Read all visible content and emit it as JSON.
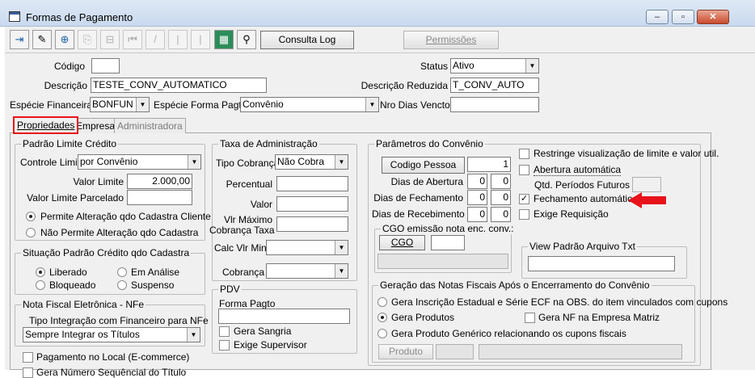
{
  "window": {
    "title": "Formas de Pagamento"
  },
  "toolbar": {
    "consulta_log": "Consulta Log",
    "permissoes": "Permissões"
  },
  "header": {
    "codigo_label": "Código",
    "codigo_value": "",
    "status_label": "Status",
    "status_value": "Ativo",
    "descricao_label": "Descrição",
    "descricao_value": "TESTE_CONV_AUTOMATICO",
    "descricao_reduzida_label": "Descrição Reduzida",
    "descricao_reduzida_value": "T_CONV_AUTO",
    "especie_financeira_label": "Espécie Financeira",
    "especie_financeira_value": "BONFUN",
    "especie_forma_label": "Espécie Forma Pagto",
    "especie_forma_value": "Convênio",
    "nro_dias_label": "Nro Dias Vencto",
    "nro_dias_value": ""
  },
  "tabs": [
    "Propriedades",
    "Empresas",
    "Administradora"
  ],
  "padrao_limite": {
    "title": "Padrão Limite Crédito",
    "controle_label": "Controle Limite",
    "controle_value": "por Convênio",
    "valor_limite_label": "Valor Limite",
    "valor_limite_value": "2.000,00",
    "valor_parcelado_label": "Valor Limite Parcelado",
    "valor_parcelado_value": "",
    "radio1": "Permite Alteração qdo Cadastra Cliente",
    "radio2": "Não Permite Alteração qdo Cadastra"
  },
  "situacao": {
    "title": "Situação Padrão Crédito qdo Cadastra",
    "liberado": "Liberado",
    "em_analise": "Em Análise",
    "bloqueado": "Bloqueado",
    "suspenso": "Suspenso"
  },
  "nfe": {
    "title": "Nota Fiscal Eletrônica - NFe",
    "tipo_label": "Tipo Integração com Financeiro para NFe",
    "tipo_value": "Sempre Integrar os Títulos"
  },
  "pagamento_local": "Pagamento no Local (E-commerce)",
  "gera_numero": "Gera Número Sequêncial do Título",
  "taxa": {
    "title": "Taxa de Administração",
    "tipo_label": "Tipo Cobrança",
    "tipo_value": "Não Cobra",
    "percentual_label": "Percentual",
    "valor_label": "Valor",
    "vlr_maximo_label1": "Vlr Máximo",
    "vlr_maximo_label2": "Cobrança Taxa",
    "calc_label": "Calc Vlr Min",
    "cobranca_label": "Cobrança"
  },
  "pdv": {
    "title": "PDV",
    "forma_label": "Forma Pagto",
    "forma_value": "",
    "gera_sangria": "Gera Sangria",
    "exige_supervisor": "Exige Supervisor"
  },
  "convenio": {
    "title": "Parâmetros do Convênio",
    "codigo_pessoa_btn": "Codigo Pessoa",
    "codigo_pessoa_value": "1",
    "dias_abertura_label": "Dias de Abertura",
    "dias_abertura_1": "0",
    "dias_abertura_2": "0",
    "dias_fechamento_label": "Dias de Fechamento",
    "dias_fechamento_1": "0",
    "dias_fechamento_2": "0",
    "dias_recebimento_label": "Dias de Recebimento",
    "dias_recebimento_1": "0",
    "dias_recebimento_2": "0",
    "restringe": "Restringe visualização de limite e valor util.",
    "abertura_auto": "Abertura automática",
    "qtd_periodos_label": "Qtd. Períodos Futuros",
    "fechamento_auto": "Fechamento automático",
    "exige_requisicao": "Exige Requisição",
    "cgo_title": "CGO emissão nota enc. conv.:",
    "cgo_btn": "CGO",
    "view_title": "View Padrão Arquivo Txt"
  },
  "geracao": {
    "title": "Geração das Notas Fiscais Após o Encerramento do Convênio",
    "radio1": "Gera Inscrição Estadual e Série ECF na OBS. do item vinculados com cupons",
    "radio2": "Gera Produtos",
    "gera_nf_matriz": "Gera NF na Empresa Matriz",
    "radio3": "Gera Produto Genérico relacionando os cupons fiscais",
    "produto_btn": "Produto"
  },
  "colors": {
    "highlight": "#e8121a",
    "arrow": "#e8121a"
  }
}
